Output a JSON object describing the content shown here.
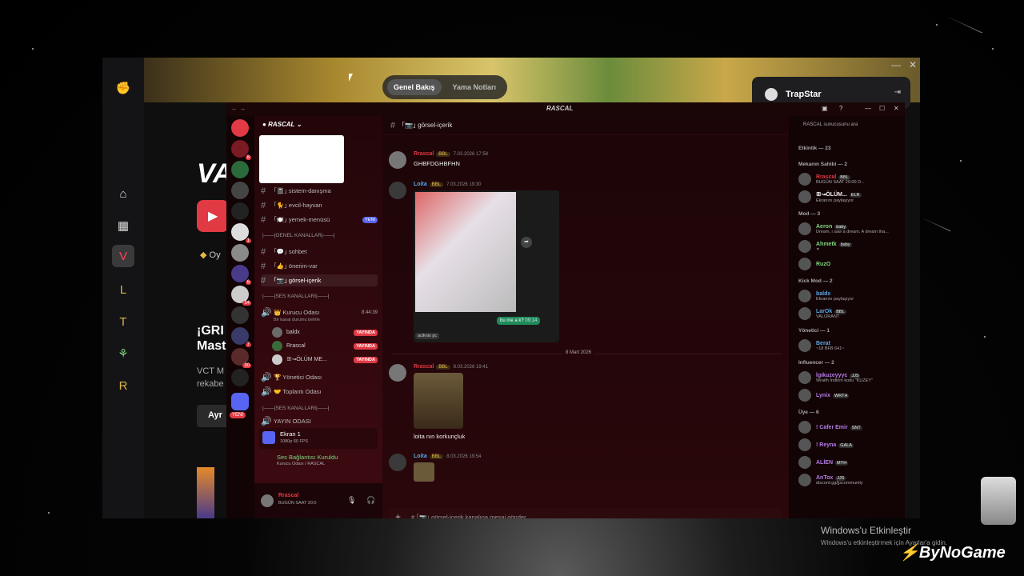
{
  "launcher": {
    "tabs": [
      "Genel Bakış",
      "Yama Notları"
    ],
    "profile_name": "TrapStar",
    "headline_line1": "¡GRI",
    "headline_line2": "Mast",
    "subtitle_line1": "VCT M",
    "subtitle_line2": "rekabe",
    "cta": "Ayr",
    "play_hint": "Oy"
  },
  "discord": {
    "window_title": "RASCAL",
    "server_name": "RASCAL",
    "channel_title": "｢📷｣ görsel-içerik",
    "search_placeholder": "RASCAL sunucusunu ara",
    "server_badges": [
      "8",
      "1",
      "6",
      "14",
      "7",
      "30"
    ],
    "server_new_label": "YENİ",
    "channels": [
      {
        "name": "｢📓｣ sistem-danışma"
      },
      {
        "name": "｢🐈｣ evcil-hayvan"
      },
      {
        "name": "｢🍽️｣ yemek-menüsü",
        "badge": "YENİ"
      },
      {
        "category": "|——|GENEL KANALLAR|——|"
      },
      {
        "name": "｢💬｣ sohbet"
      },
      {
        "name": "｢👍｣ önerim-var"
      },
      {
        "name": "｢📷｣ görsel-içerik",
        "selected": true
      },
      {
        "category": "|——|SES KANALLARI|——|"
      }
    ],
    "voice_room": {
      "name": "👑 Kurucu Odası",
      "time": "8:44:39",
      "status": "Bir kanal durumu belirle"
    },
    "voice_users": [
      {
        "name": "baldx",
        "live": "YAYINDA"
      },
      {
        "name": "Rrascal",
        "live": "YAYINDA"
      },
      {
        "name": "ꕥ↝ÖLÜM ME...",
        "live": "YAYINDA"
      }
    ],
    "voice_rooms_more": [
      "🏆 Yönetici Odası",
      "🤝 Toplantı Odası"
    ],
    "category_3": "|——|SES KANALLARI|——|",
    "voice_room_3": "YAYIN ODASI",
    "screen": {
      "title": "Ekran 1",
      "fps": "1080p 60 FPS"
    },
    "connection": {
      "title": "Ses Bağlantısı Kuruldu",
      "sub": "Kurucu Odası / RASCAL"
    },
    "me": {
      "name": "Rrascal",
      "status": "BUGÜN SAAT 20:0"
    },
    "messages": [
      {
        "user": "Rrascal",
        "tag": "BBL",
        "time": "7.03.2026 17:58",
        "text": "GHBFDGHBFHN",
        "color": "#e13a44"
      },
      {
        "user": "Loita",
        "tag": "BBL",
        "time": "7.03.2026 19:30",
        "text": "",
        "color": "#5aa9e6",
        "reply": "bu me a k?",
        "reply_time": "09:14",
        "caption": "aciknis pc"
      },
      {
        "divider": "8 Mart 2026"
      },
      {
        "user": "Rrascal",
        "tag": "BBL",
        "time": "8.03.2026 19:41",
        "text": "loita nın korkunçluk",
        "color": "#e13a44"
      },
      {
        "user": "Loita",
        "tag": "BBL",
        "time": "8.03.2026 19:54",
        "text": "",
        "color": "#5aa9e6"
      }
    ],
    "composer_placeholder": "# ｢📷｣ görsel-içerik kanalına mesaj gönder",
    "members_header": "Etkinlik — 23",
    "member_groups": [
      {
        "title": "Mekanın Sahibi — 2",
        "members": [
          {
            "name": "Rrascal",
            "tag": "BBL",
            "status": "BUGÜN SAAT 20:00 D...",
            "color": "#e13a44"
          },
          {
            "name": "ꕥ↝ÖLÜM...",
            "tag": "ELR",
            "status": "Ekranını paylaşıyor",
            "color": "#f0f0f0"
          }
        ]
      },
      {
        "title": "Mod — 3",
        "members": [
          {
            "name": "Aeron",
            "tag": "baby",
            "status": "Dream, i saw a dream. A dream tha...",
            "color": "#7fd67f"
          },
          {
            "name": "Ahmetk",
            "tag": "baby",
            "status": "✦",
            "color": "#7fd67f"
          },
          {
            "name": "RuzO",
            "tag": "",
            "status": "",
            "color": "#7fd67f"
          }
        ]
      },
      {
        "title": "Kick Mod — 2",
        "members": [
          {
            "name": "baldx",
            "tag": "",
            "status": "Ekranını paylaşıyor",
            "color": "#5aa9e6"
          },
          {
            "name": "LarOk",
            "tag": "BBL",
            "status": "VALORANT",
            "color": "#5aa9e6"
          }
        ]
      },
      {
        "title": "Yönetici — 1",
        "members": [
          {
            "name": "Berat",
            "tag": "",
            "status": "~18 BFB 641~",
            "color": "#5aa9e6"
          }
        ]
      },
      {
        "title": "Influencer — 2",
        "members": [
          {
            "name": "İgıkuzeyyyc",
            "tag": "JJS",
            "status": "Wraith İndirim kodu \"KUZEY\"",
            "color": "#b57be6"
          },
          {
            "name": "Lynix",
            "tag": "WRTH",
            "status": "",
            "color": "#b57be6"
          }
        ]
      },
      {
        "title": "Üye — 6",
        "members": [
          {
            "name": "! Cafer Emir",
            "tag": "SNT",
            "status": "",
            "color": "#b57be6"
          },
          {
            "name": "! Reyna",
            "tag": "GALA",
            "status": "",
            "color": "#b57be6"
          },
          {
            "name": "ALİEN",
            "tag": "MYH",
            "status": "",
            "color": "#b57be6"
          },
          {
            "name": "AnTox",
            "tag": "JJS",
            "status": "discord.gg/jjscommunity",
            "color": "#b57be6"
          }
        ]
      }
    ]
  },
  "desktop": {
    "watermark_title": "Windows'u Etkinleştir",
    "watermark_sub": "Windows'u etkinleştirmek için Ayarlar'a gidin.",
    "brand": "ByNoGame"
  }
}
